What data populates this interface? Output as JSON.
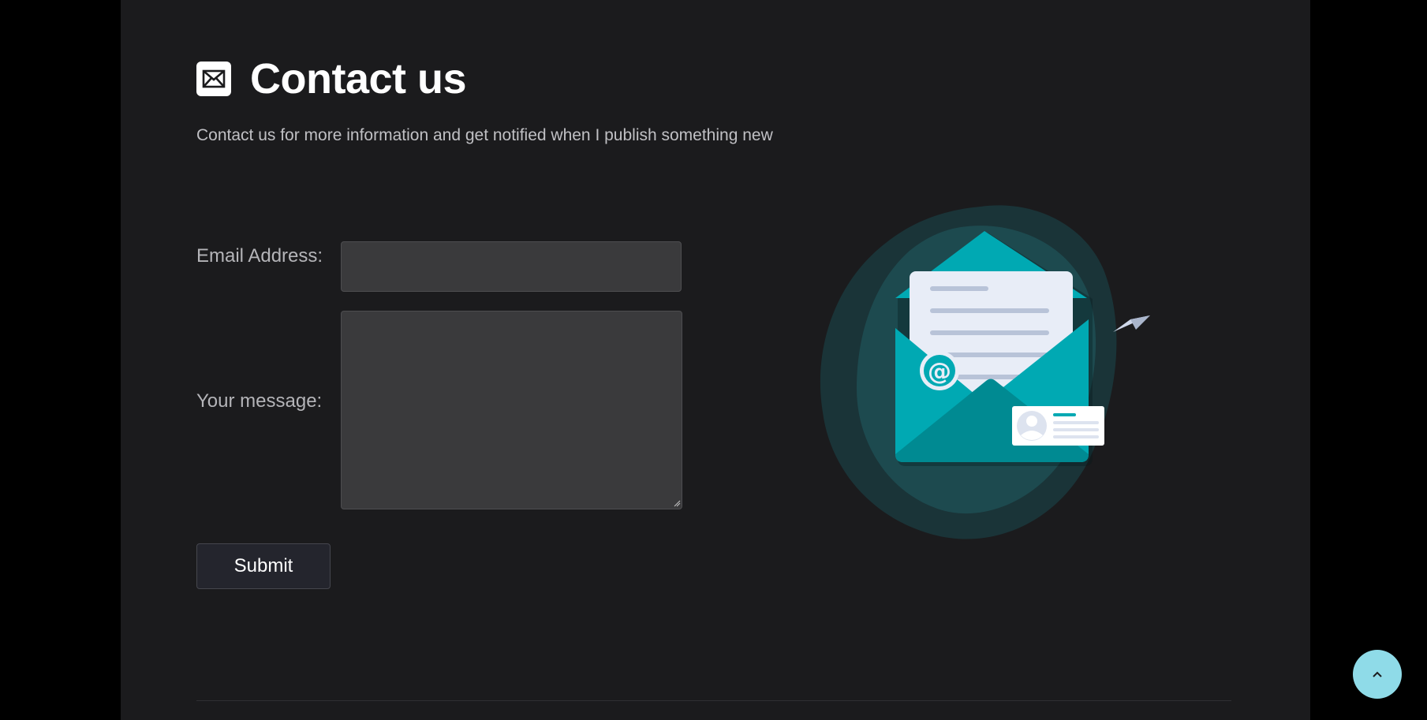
{
  "header": {
    "title": "Contact us",
    "subtitle": "Contact us for more information and get notified when I publish something new",
    "icon": "envelope-icon"
  },
  "form": {
    "email_label": "Email Address:",
    "email_value": "",
    "message_label": "Your message:",
    "message_value": "",
    "submit_label": "Submit"
  },
  "illustration": {
    "icon": "open-envelope-illustration",
    "at_symbol": "@",
    "colors": {
      "blob_outer": "#1a3438",
      "blob_inner": "#1d4a4f",
      "envelope": "#00a9b3",
      "envelope_dark": "#008a92",
      "letter": "#e8edf7"
    }
  },
  "scroll_top": {
    "icon": "chevron-up-icon",
    "color": "#8fdbe8"
  },
  "colors": {
    "page_background": "#1b1b1d",
    "outer_background": "#000000",
    "input_background": "#3a3a3c"
  }
}
